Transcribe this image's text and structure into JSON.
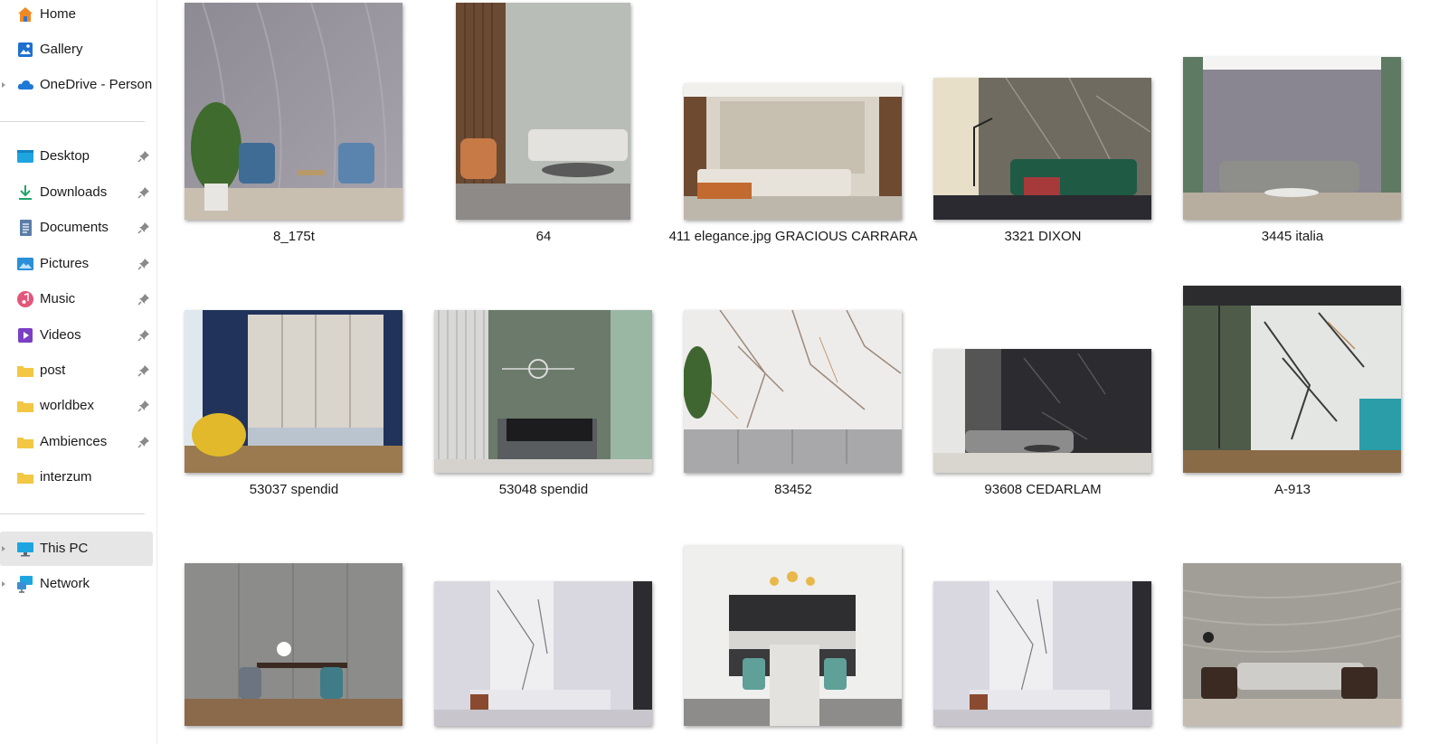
{
  "sidebar": {
    "items": [
      {
        "label": "Home",
        "icon": "home-icon"
      },
      {
        "label": "Gallery",
        "icon": "gallery-icon"
      },
      {
        "label": "OneDrive - Persona",
        "icon": "onedrive-cloud-icon"
      },
      {
        "label": "Desktop",
        "icon": "desktop-folder-icon"
      },
      {
        "label": "Downloads",
        "icon": "downloads-arrow-icon"
      },
      {
        "label": "Documents",
        "icon": "documents-icon"
      },
      {
        "label": "Pictures",
        "icon": "pictures-icon"
      },
      {
        "label": "Music",
        "icon": "music-icon"
      },
      {
        "label": "Videos",
        "icon": "videos-icon"
      },
      {
        "label": "post",
        "icon": "folder-icon"
      },
      {
        "label": "worldbex",
        "icon": "folder-icon"
      },
      {
        "label": "Ambiences",
        "icon": "folder-icon"
      },
      {
        "label": "interzum",
        "icon": "folder-icon"
      },
      {
        "label": "This PC",
        "icon": "this-pc-icon"
      },
      {
        "label": "Network",
        "icon": "network-icon"
      }
    ],
    "selected": "This PC"
  },
  "files": [
    {
      "name": "8_175t"
    },
    {
      "name": "64"
    },
    {
      "name": "411 elegance.jpg GRACIOUS CARRARA"
    },
    {
      "name": "3321 DIXON"
    },
    {
      "name": "3445 italia"
    },
    {
      "name": "53037 spendid"
    },
    {
      "name": "53048 spendid"
    },
    {
      "name": "83452"
    },
    {
      "name": "93608 CEDARLAM"
    },
    {
      "name": "A-913"
    },
    {
      "name": ""
    },
    {
      "name": ""
    },
    {
      "name": ""
    },
    {
      "name": ""
    },
    {
      "name": ""
    }
  ],
  "colors": {
    "selected_bg": "#e6e6e6",
    "folder_yellow": "#f2c744",
    "pin": "#8a8a8a"
  }
}
